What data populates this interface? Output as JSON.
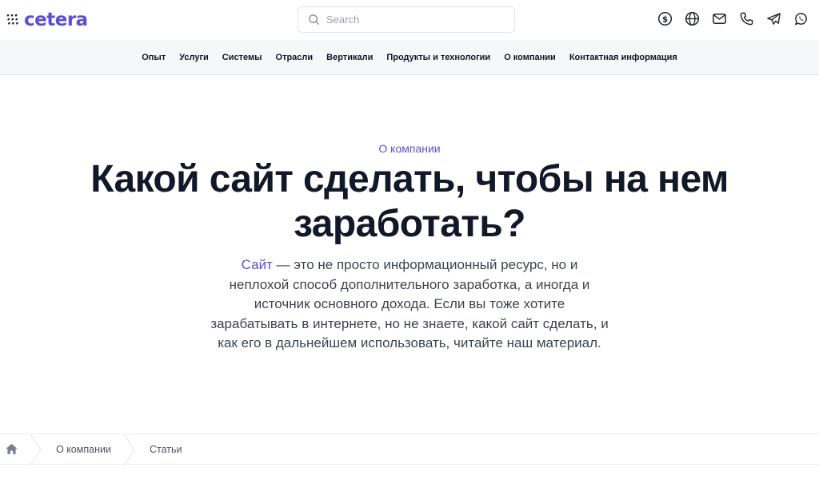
{
  "header": {
    "brand": "cetera",
    "brand_color": "#5b4fd1",
    "search": {
      "placeholder": "Search",
      "value": ""
    },
    "icons": [
      "currency-icon",
      "globe-icon",
      "mail-icon",
      "phone-icon",
      "telegram-icon",
      "whatsapp-icon"
    ]
  },
  "nav": {
    "items": [
      "Опыт",
      "Услуги",
      "Системы",
      "Отрасли",
      "Вертикали",
      "Продукты и технологии",
      "О компании",
      "Контактная информация"
    ]
  },
  "hero": {
    "eyebrow": "О компании",
    "title": "Какой сайт сделать, чтобы на нем заработать?",
    "intro_link": "Сайт",
    "intro_text": " — это не просто информационный ресурс, но и неплохой способ дополнительного заработка, а иногда и источник основного дохода. Если вы тоже хотите зарабатывать в интернете, но не знаете, какой сайт сделать, и как его в дальнейшем использовать, читайте наш материал."
  },
  "breadcrumb": {
    "items": [
      "О компании",
      "Статьи"
    ]
  }
}
